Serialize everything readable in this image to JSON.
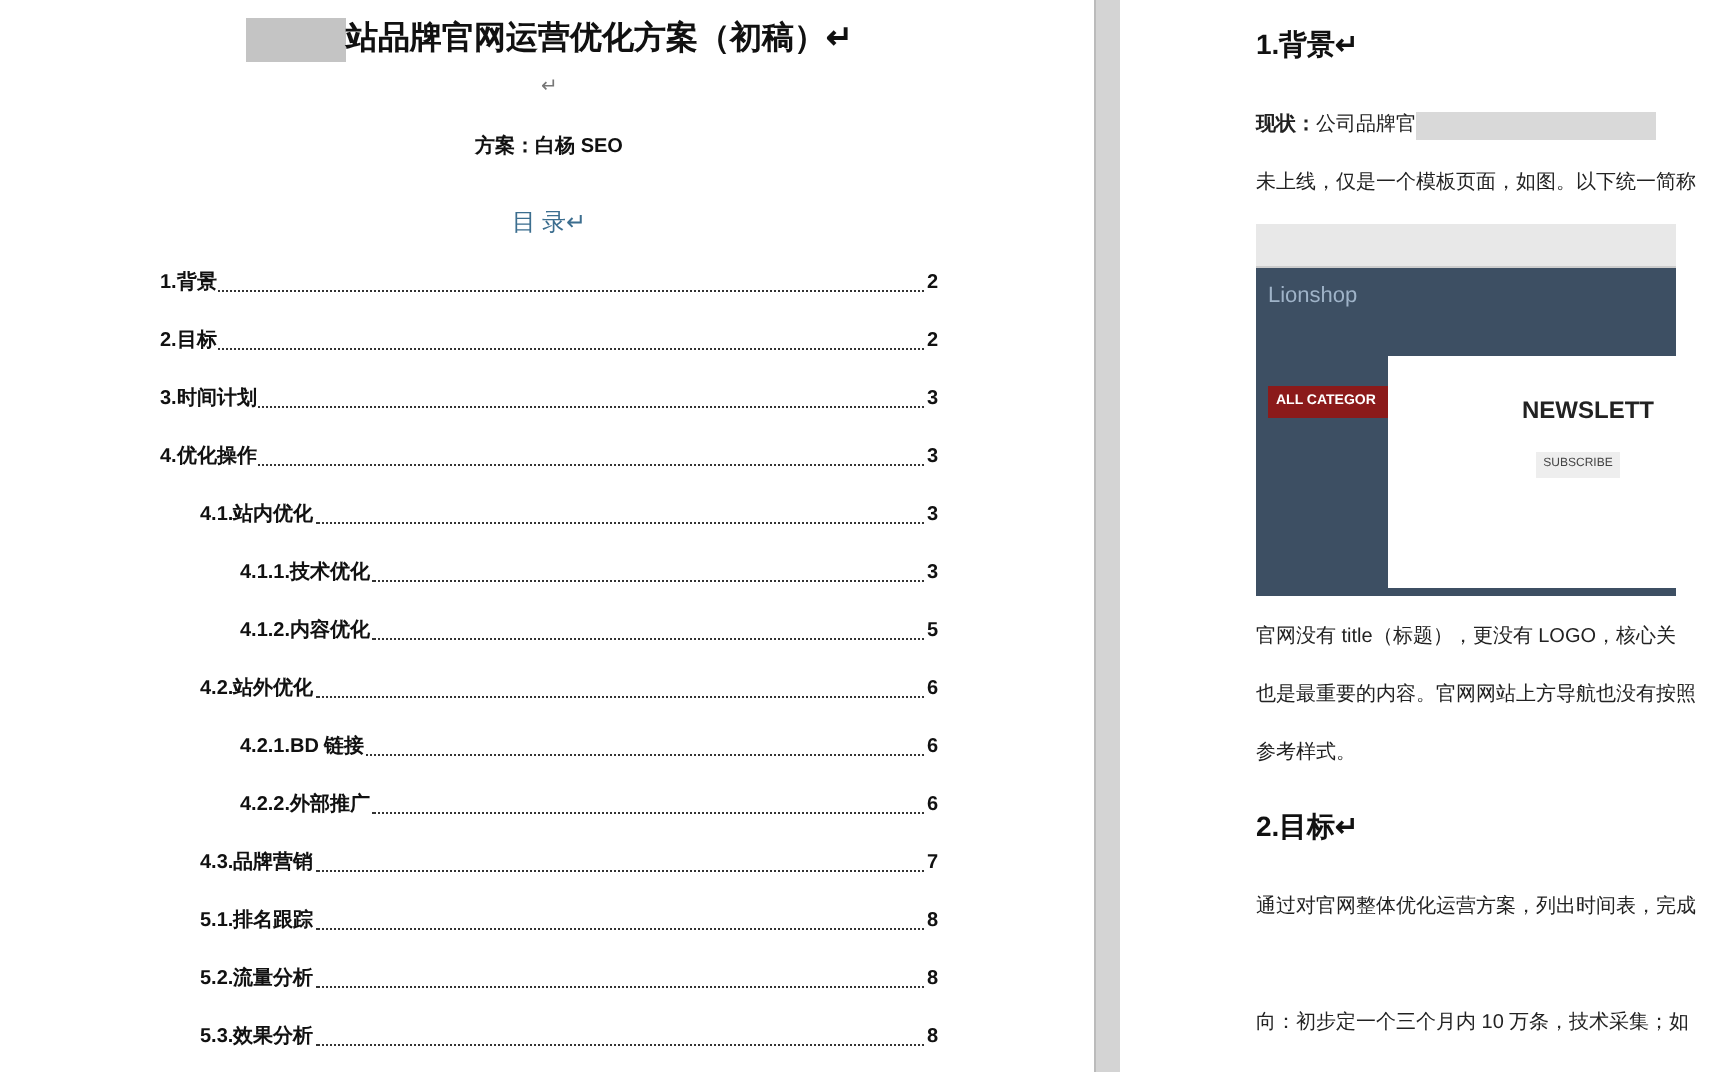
{
  "left_page": {
    "title": "站品牌官网运营优化方案（初稿）↵",
    "blank_line": "↵",
    "author": "方案：白杨 SEO",
    "toc_heading": "目 录↵",
    "toc": [
      {
        "label": "1.背景",
        "page": "2"
      },
      {
        "label": "2.目标",
        "page": "2"
      },
      {
        "label": "3.时间计划",
        "page": "3"
      },
      {
        "label": "4.优化操作",
        "page": "3",
        "children": [
          {
            "label": "4.1.站内优化",
            "page": "3",
            "children": [
              {
                "label": "4.1.1.技术优化",
                "page": "3"
              },
              {
                "label": "4.1.2.内容优化",
                "page": "5"
              }
            ]
          },
          {
            "label": "4.2.站外优化",
            "page": "6",
            "children": [
              {
                "label": "4.2.1.BD 链接",
                "page": "6"
              },
              {
                "label": "4.2.2.外部推广",
                "page": "6"
              }
            ]
          },
          {
            "label": "4.3.品牌营销",
            "page": "7"
          },
          {
            "label": "5.1.排名跟踪",
            "page": "8"
          },
          {
            "label": "5.2.流量分析",
            "page": "8"
          },
          {
            "label": "5.3.效果分析",
            "page": "8"
          }
        ]
      }
    ]
  },
  "right_page": {
    "blocks": [
      {
        "kind": "heading",
        "text": "1.背景↵"
      },
      {
        "kind": "paragraph",
        "text": "**现状：**公司品牌官",
        "redacted": true
      },
      {
        "kind": "paragraph",
        "text": "未上线，仅是一个模板页面，如图。以下统一简称"
      },
      {
        "kind": "screenshot",
        "logo": "Lionshop",
        "category": "ALL CATEGOR",
        "modal_title": "NEWSLETT",
        "modal_button": "SUBSCRIBE"
      },
      {
        "kind": "paragraph",
        "text": "官网没有 title（标题），更没有 LOGO，核心关"
      },
      {
        "kind": "paragraph",
        "text": "也是最重要的内容。官网网站上方导航也没有按照"
      },
      {
        "kind": "paragraph",
        "text": "参考样式。"
      },
      {
        "kind": "heading",
        "text": "2.目标↵"
      },
      {
        "kind": "paragraph",
        "text": "通过对官网整体优化运营方案，列出时间表，完成"
      },
      {
        "kind": "gap"
      },
      {
        "kind": "paragraph",
        "text": "向：初步定一个三个月内 10 万条，技术采集；如"
      }
    ]
  }
}
